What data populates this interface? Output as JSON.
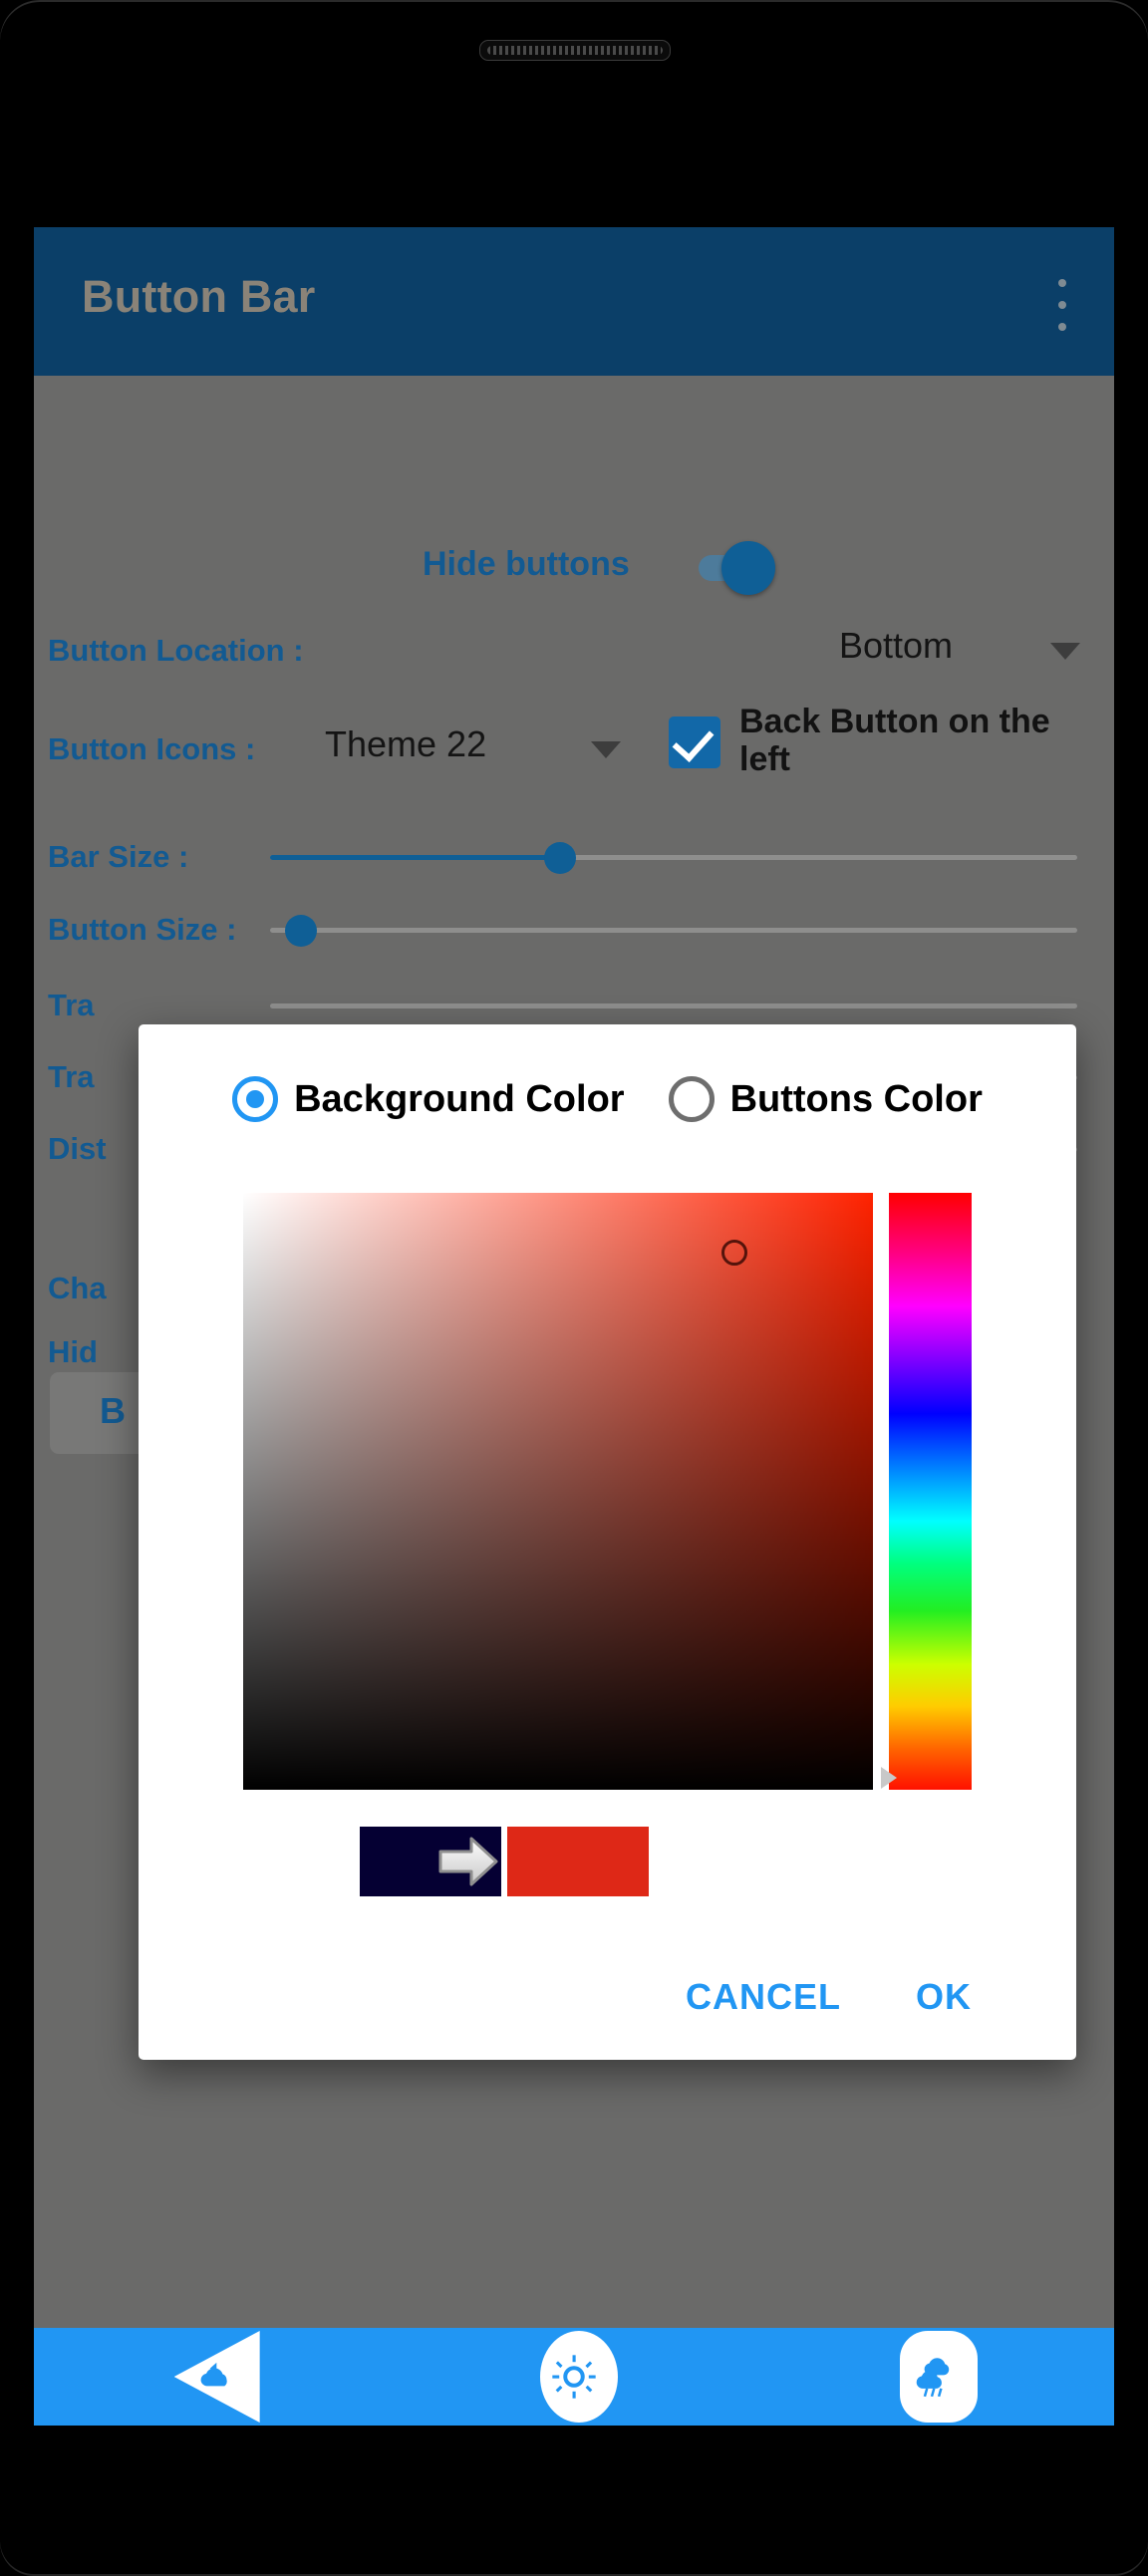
{
  "app": {
    "title": "Button Bar",
    "appbar_color": "#0b3f68",
    "overflow_icon": "vertical-dots-icon"
  },
  "settings": {
    "hide_buttons": {
      "label": "Hide buttons",
      "state": "on"
    },
    "button_location": {
      "label": "Button Location :",
      "value": "Bottom"
    },
    "button_icons": {
      "label": "Button Icons :",
      "value": "Theme 22"
    },
    "back_button_left": {
      "label": "Back Button on the left",
      "checked": true
    },
    "bar_size": {
      "label": "Bar Size :",
      "percent": 36
    },
    "button_size": {
      "label": "Button Size :",
      "percent": 3
    },
    "obscured_rows": [
      {
        "label": "Tra"
      },
      {
        "label": "Tra"
      },
      {
        "label": "Dist"
      },
      {
        "label": "Cha",
        "checked": false
      },
      {
        "label": "Hid",
        "checked": false
      }
    ],
    "action_button_label": "B"
  },
  "dialog": {
    "options": [
      {
        "label": "Background Color",
        "selected": true
      },
      {
        "label": "Buttons Color",
        "selected": false
      }
    ],
    "picker": {
      "hue_color": "#ff2200",
      "marker_x_percent": 78,
      "marker_y_percent": 10,
      "hue_marker_percent": 98
    },
    "swatch_old": "#050033",
    "swatch_new": "#de2817",
    "arrow_icon": "right-arrow-icon",
    "cancel_label": "CANCEL",
    "ok_label": "OK",
    "accent": "#2196f3"
  },
  "navbar": {
    "color": "#2196f3",
    "buttons": [
      {
        "name": "back",
        "icon": "cloud-back-icon"
      },
      {
        "name": "home",
        "icon": "sun-icon"
      },
      {
        "name": "recents",
        "icon": "rain-cloud-icon"
      }
    ]
  }
}
